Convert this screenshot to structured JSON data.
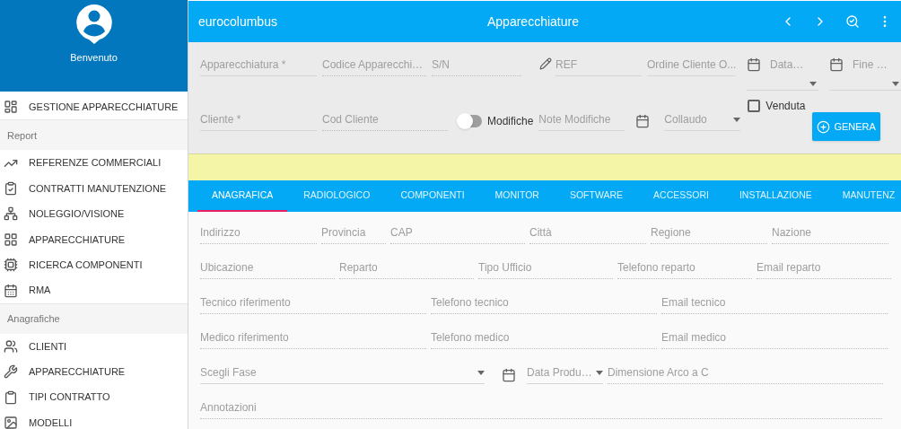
{
  "sidebar": {
    "greeting": "Benvenuto",
    "groups": [
      {
        "items": [
          {
            "label": "GESTIONE APPARECCHIATURE"
          }
        ]
      },
      {
        "heading": "Report",
        "items": [
          {
            "label": "REFERENZE COMMERCIALI"
          },
          {
            "label": "CONTRATTI MANUTENZIONE"
          },
          {
            "label": "NOLEGGIO/VISIONE"
          },
          {
            "label": "APPARECCHIATURE"
          },
          {
            "label": "RICERCA COMPONENTI"
          },
          {
            "label": "RMA"
          }
        ]
      },
      {
        "heading": "Anagrafiche",
        "items": [
          {
            "label": "CLIENTI"
          },
          {
            "label": "APPARECCHIATURE"
          },
          {
            "label": "TIPI CONTRATTO"
          },
          {
            "label": "MODELLI"
          }
        ]
      }
    ]
  },
  "toolbar": {
    "brand": "eurocolumbus",
    "title": "Apparecchiature"
  },
  "form": {
    "row_1": [
      {
        "kind": "text",
        "placeholder": "Apparecchiatura *",
        "disabled": false
      },
      {
        "kind": "text",
        "placeholder": "Codice Apparecchi…",
        "disabled": true
      },
      {
        "kind": "text",
        "placeholder": "S/N",
        "disabled": true
      },
      {
        "kind": "edit",
        "placeholder": "REF",
        "disabled": false
      },
      {
        "kind": "text",
        "placeholder": "Ordine Cliente O...",
        "disabled": false
      },
      {
        "kind": "date",
        "placeholder": "Data…"
      },
      {
        "kind": "date",
        "placeholder": "Fine …"
      }
    ],
    "row_2": [
      {
        "kind": "text",
        "placeholder": "Cliente *",
        "disabled": false
      },
      {
        "kind": "text",
        "placeholder": "Cod Cliente",
        "disabled": true
      },
      {
        "kind": "switch",
        "label": "Modifiche",
        "on": false
      },
      {
        "kind": "text",
        "placeholder": "Note Modifiche",
        "disabled": false
      },
      {
        "kind": "select",
        "placeholder": "Collaudo"
      },
      {
        "kind": "checkbox",
        "label": "Venduta",
        "checked": false
      },
      {
        "kind": "button",
        "label": "GENERA"
      }
    ]
  },
  "tabs": [
    {
      "label": "ANAGRAFICA",
      "selected": true
    },
    {
      "label": "RADIOLOGICO",
      "selected": false
    },
    {
      "label": "COMPONENTI",
      "selected": false
    },
    {
      "label": "MONITOR",
      "selected": false
    },
    {
      "label": "SOFTWARE",
      "selected": false
    },
    {
      "label": "ACCESSORI",
      "selected": false
    },
    {
      "label": "INSTALLAZIONE",
      "selected": false
    },
    {
      "label": "MANUTENZ",
      "selected": false
    }
  ],
  "details": [
    [
      {
        "kind": "text",
        "placeholder": "Indirizzo"
      },
      {
        "kind": "text",
        "placeholder": "Provincia"
      },
      {
        "kind": "text",
        "placeholder": "CAP"
      },
      {
        "kind": "text",
        "placeholder": "Città"
      },
      {
        "kind": "text",
        "placeholder": "Regione"
      },
      {
        "kind": "text",
        "placeholder": "Nazione"
      }
    ],
    [
      {
        "kind": "text",
        "placeholder": "Ubicazione"
      },
      {
        "kind": "text",
        "placeholder": "Reparto"
      },
      {
        "kind": "text",
        "placeholder": "Tipo Ufficio"
      },
      {
        "kind": "text",
        "placeholder": "Telefono reparto"
      },
      {
        "kind": "text",
        "placeholder": "Email reparto"
      }
    ],
    [
      {
        "kind": "text",
        "placeholder": "Tecnico riferimento"
      },
      {
        "kind": "text",
        "placeholder": "Telefono tecnico"
      },
      {
        "kind": "text",
        "placeholder": "Email tecnico"
      }
    ],
    [
      {
        "kind": "text",
        "placeholder": "Medico riferimento"
      },
      {
        "kind": "text",
        "placeholder": "Telefono medico"
      },
      {
        "kind": "text",
        "placeholder": "Email medico"
      }
    ],
    [
      {
        "kind": "select",
        "placeholder": "Scegli Fase"
      },
      {
        "kind": "date",
        "placeholder": "Data Produ…"
      },
      {
        "kind": "text",
        "placeholder": "Dimensione Arco a C"
      }
    ],
    [
      {
        "kind": "text",
        "placeholder": "Annotazioni"
      }
    ]
  ]
}
